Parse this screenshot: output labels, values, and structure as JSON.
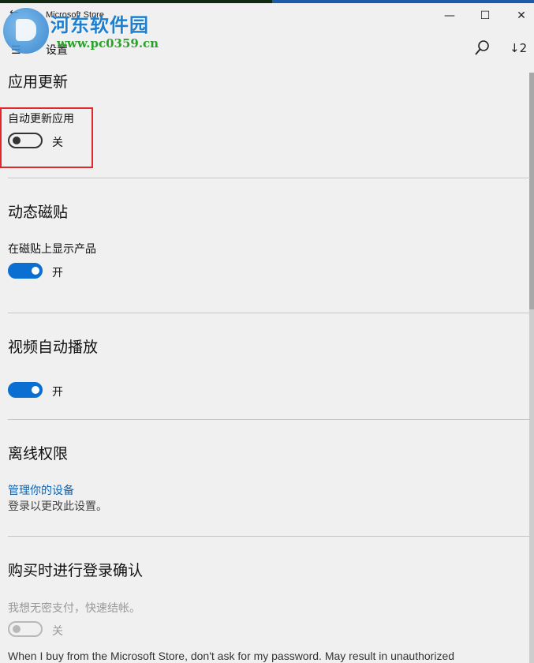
{
  "window": {
    "title": "Microsoft Store",
    "minimize": "—",
    "maximize": "☐",
    "close": "✕",
    "back": "←"
  },
  "watermark": {
    "text": "河东软件园",
    "url": "www.pc0359.cn"
  },
  "nav": {
    "menu": "☰",
    "page_title": "设置",
    "downloads_label": "↓2"
  },
  "app_updates": {
    "heading": "应用更新",
    "setting_label": "自动更新应用",
    "toggle_state": "关",
    "toggle_on": false
  },
  "live_tile": {
    "heading": "动态磁贴",
    "setting_label": "在磁贴上显示产品",
    "toggle_state": "开",
    "toggle_on": true
  },
  "video_autoplay": {
    "heading": "视频自动播放",
    "toggle_state": "开",
    "toggle_on": true
  },
  "offline": {
    "heading": "离线权限",
    "link": "管理你的设备",
    "note": "登录以更改此设置。"
  },
  "purchase_signin": {
    "heading": "购买时进行登录确认",
    "setting_label": "我想无密支付，快速结帐。",
    "toggle_state": "关",
    "toggle_on": false,
    "footer": "When I buy from the Microsoft Store, don't ask for my password. May result in unauthorized"
  },
  "colors": {
    "accent": "#0a6fd0",
    "highlight": "#e0282e",
    "link": "#0a64b5"
  }
}
